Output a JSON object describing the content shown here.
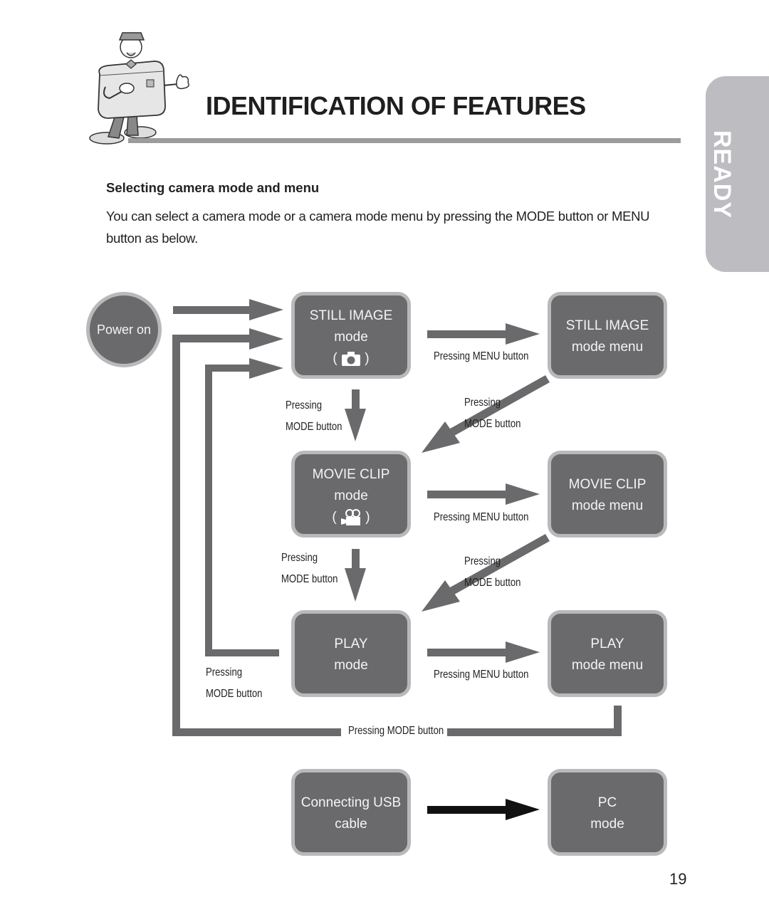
{
  "header": {
    "title": "IDENTIFICATION OF FEATURES",
    "side_tab": "READY",
    "mascot": "camera-mascot-illustration"
  },
  "section": {
    "heading": "Selecting camera mode and menu",
    "intro": "You can select a camera mode or a camera mode menu by pressing the MODE button or MENU button as below."
  },
  "diagram": {
    "start": "Power on",
    "modes": [
      {
        "line1": "STILL IMAGE",
        "line2": "mode",
        "icon": "camera-icon"
      },
      {
        "line1": "MOVIE CLIP",
        "line2": "mode",
        "icon": "movie-camera-icon"
      },
      {
        "line1": "PLAY",
        "line2": "mode"
      }
    ],
    "menus": [
      {
        "line1": "STILL IMAGE",
        "line2": "mode menu"
      },
      {
        "line1": "MOVIE CLIP",
        "line2": "mode menu"
      },
      {
        "line1": "PLAY",
        "line2": "mode menu"
      }
    ],
    "usb": {
      "line1": "Connecting USB",
      "line2": "cable"
    },
    "pc": {
      "line1": "PC",
      "line2": "mode"
    },
    "labels": {
      "menu_button": "Pressing MENU button",
      "pressing": "Pressing",
      "mode_button": "MODE button",
      "pressing_mode_button": "Pressing MODE button"
    },
    "icon_paren_open": "(",
    "icon_paren_close": ")"
  },
  "footer": {
    "page_number": "19"
  },
  "colors": {
    "box_fill": "#6a6a6c",
    "box_border": "#b9b9bb",
    "arrow": "#6a6a6c",
    "usb_arrow": "#111111",
    "tab": "#bdbdc1"
  }
}
